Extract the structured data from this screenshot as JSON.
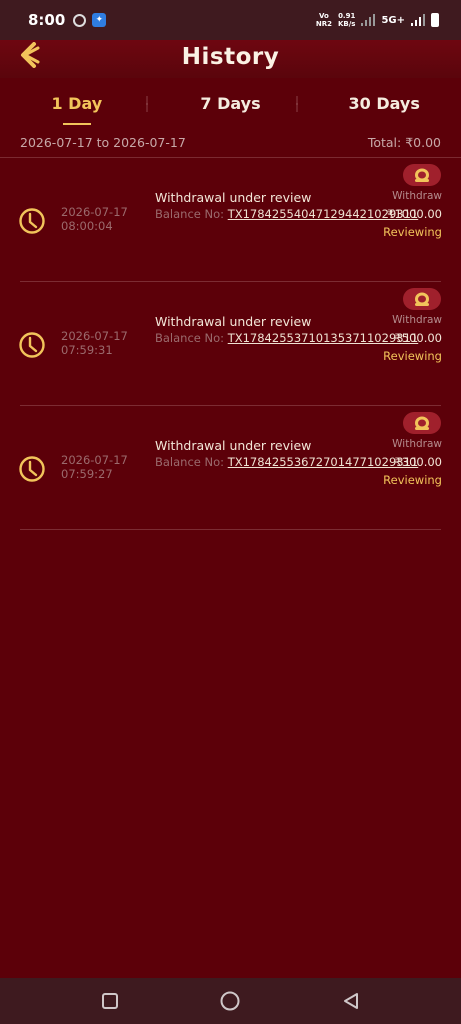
{
  "status_bar": {
    "time": "8:00",
    "volte_top": "Vo",
    "volte_bottom": "NR2",
    "speed_value": "0.91",
    "speed_unit": "KB/s",
    "network": "5G+"
  },
  "header": {
    "title": "History",
    "back_icon": "back-arrow-icon"
  },
  "tabs": [
    {
      "label": "1 Day",
      "active": true
    },
    {
      "label": "7 Days",
      "active": false
    },
    {
      "label": "30 Days",
      "active": false
    }
  ],
  "range": {
    "text": "2026-07-17 to 2026-07-17",
    "total": "Total: ₹0.00"
  },
  "records": [
    {
      "date": "2026-07-17",
      "time": "08:00:04",
      "title": "Withdrawal under review",
      "balance_label": "Balance No:",
      "tx_id": "TX17842554047129442102931​1",
      "amount": "₹1000.00",
      "type": "Withdraw",
      "status": "Reviewing"
    },
    {
      "date": "2026-07-17",
      "time": "07:59:31",
      "title": "Withdrawal under review",
      "balance_label": "Balance No:",
      "tx_id": "TX178425537101353711029311",
      "amount": "₹500.00",
      "type": "Withdraw",
      "status": "Reviewing"
    },
    {
      "date": "2026-07-17",
      "time": "07:59:27",
      "title": "Withdrawal under review",
      "balance_label": "Balance No:",
      "tx_id": "TX178425536727014771029311",
      "amount": "₹300.00",
      "type": "Withdraw",
      "status": "Reviewing"
    }
  ],
  "colors": {
    "background": "#5c0009",
    "accent": "#f2c45b",
    "status_bar": "#3f1a1f",
    "badge": "#a0202c"
  },
  "nav": {
    "recent": "square-icon",
    "home": "circle-icon",
    "back": "triangle-back-icon"
  }
}
